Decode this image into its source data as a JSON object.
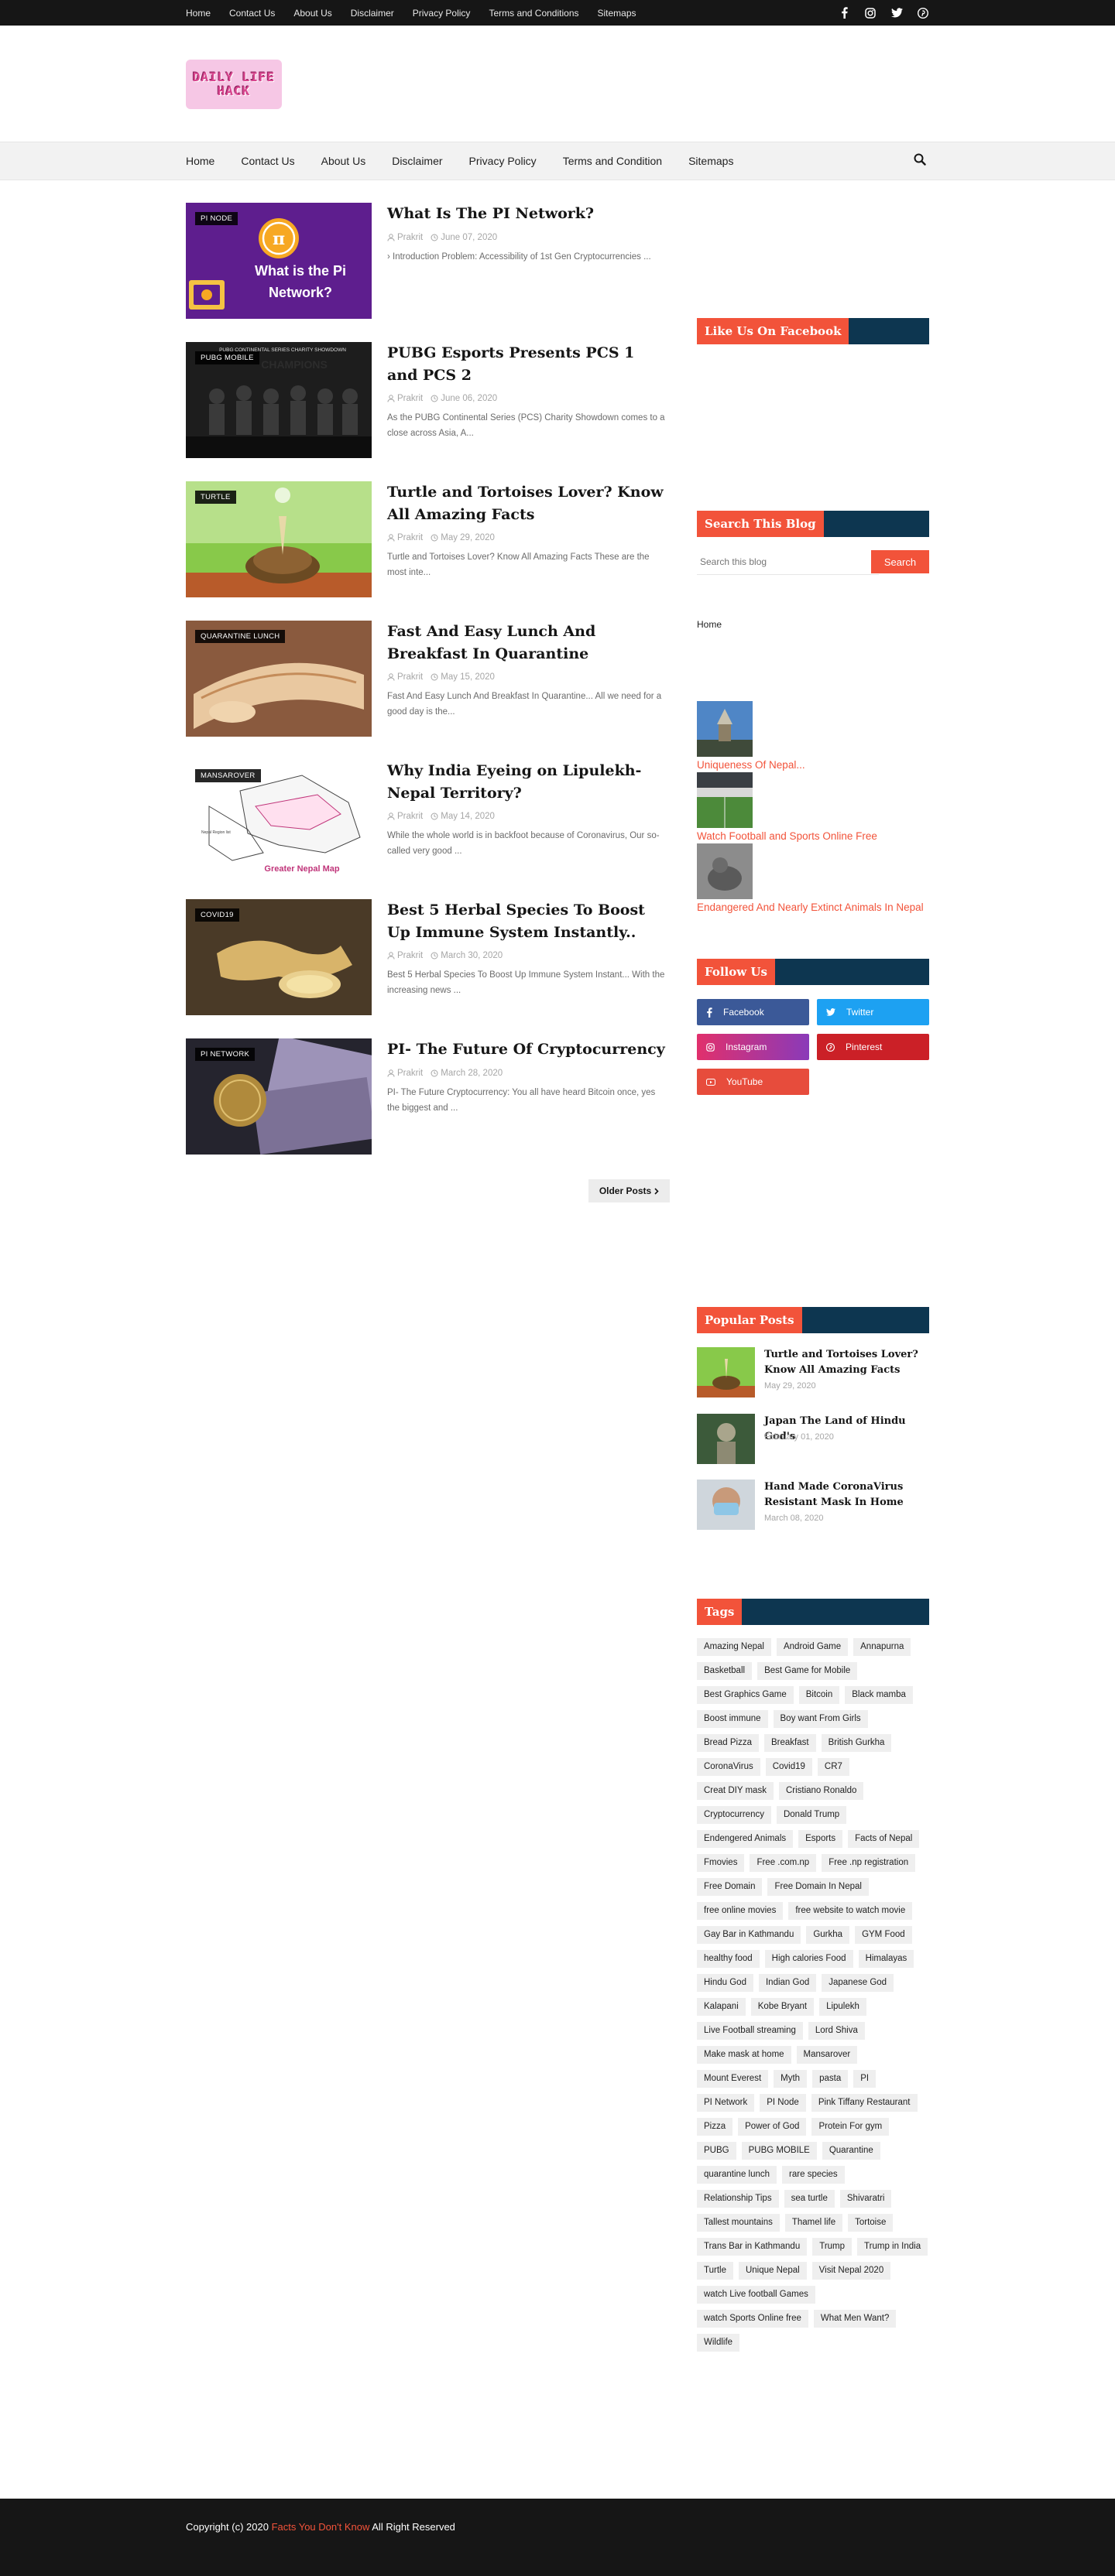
{
  "topbar": {
    "links": [
      "Home",
      "Contact Us",
      "About Us",
      "Disclaimer",
      "Privacy Policy",
      "Terms and Conditions",
      "Sitemaps"
    ],
    "social_icons": [
      "facebook-icon",
      "instagram-icon",
      "twitter-icon",
      "pinterest-icon"
    ]
  },
  "header": {
    "logo_line1": "DAILY LIFE",
    "logo_line2": "HACK"
  },
  "mainnav": {
    "links": [
      "Home",
      "Contact Us",
      "About Us",
      "Disclaimer",
      "Privacy Policy",
      "Terms and Condition",
      "Sitemaps"
    ],
    "search_icon": "search-icon"
  },
  "posts": [
    {
      "label": "PI NODE",
      "title": "What Is The PI Network?",
      "author": "Prakrit",
      "date": "June 07, 2020",
      "snippet": "› Introduction Problem: Accessibility of 1st Gen Cryptocurrencies ...",
      "thumb_text": "What is the Pi Network?",
      "thumb_color": "#6a1b9a"
    },
    {
      "label": "PUBG MOBILE",
      "title": "PUBG Esports Presents PCS 1 and PCS 2",
      "author": "Prakrit",
      "date": "June 06, 2020",
      "snippet": "As the PUBG Continental Series (PCS) Charity Showdown comes to a close across Asia, A...",
      "thumb_text": "PUBG CONTINENTAL SERIES CHARITY SHOWDOWN",
      "thumb_color": "#111111"
    },
    {
      "label": "TURTLE",
      "title": "Turtle and Tortoises Lover? Know All Amazing Facts",
      "author": "Prakrit",
      "date": "May 29, 2020",
      "snippet": "Turtle and Tortoises Lover? Know All Amazing Facts  These are the most inte...",
      "thumb_text": "",
      "thumb_color": "#7bbf3a"
    },
    {
      "label": "QUARANTINE LUNCH",
      "title": "Fast And Easy Lunch And Breakfast In Quarantine",
      "author": "Prakrit",
      "date": "May 15, 2020",
      "snippet": "Fast And Easy Lunch And Breakfast In Quarantine...   All we need for a good day is the...",
      "thumb_text": "",
      "thumb_color": "#d9a273"
    },
    {
      "label": "MANSAROVER",
      "title": "Why India Eyeing on Lipulekh-Nepal Territory?",
      "author": "Prakrit",
      "date": "May 14, 2020",
      "snippet": "While the whole world is in backfoot because of Coronavirus, Our so-called very good ...",
      "thumb_text": "Greater Nepal Map",
      "thumb_color": "#ffffff"
    },
    {
      "label": "COVID19",
      "title": "Best 5 Herbal Species To Boost Up Immune System Instantly..",
      "author": "Prakrit",
      "date": "March 30, 2020",
      "snippet": "Best 5 Herbal Species To Boost Up Immune System Instant...   With the increasing news ...",
      "thumb_text": "",
      "thumb_color": "#6b5535"
    },
    {
      "label": "PI NETWORK",
      "title": "PI- The Future Of Cryptocurrency",
      "author": "Prakrit",
      "date": "March 28, 2020",
      "snippet": "PI- The Future Cryptocurrency: You all have heard Bitcoin once, yes the biggest and ...",
      "thumb_text": "",
      "thumb_color": "#2b2b3a"
    }
  ],
  "pagination": {
    "older_label": "Older Posts"
  },
  "sidebar": {
    "facebook_title": "Like Us On Facebook",
    "search_title": "Search This Blog",
    "search_placeholder": "Search this blog",
    "search_button": "Search",
    "home_link": "Home",
    "image_links": [
      "Uniqueness Of Nepal...",
      "Watch Football and Sports Online Free",
      "Endangered And Nearly Extinct Animals In Nepal"
    ],
    "follow_title": "Follow Us",
    "follow_buttons": [
      {
        "label": "Facebook",
        "color": "#3b5998",
        "icon": "facebook-icon"
      },
      {
        "label": "Twitter",
        "color": "#1da1f2",
        "icon": "twitter-icon"
      },
      {
        "label": "Instagram",
        "color": "#c13584",
        "icon": "instagram-icon"
      },
      {
        "label": "Pinterest",
        "color": "#cb2027",
        "icon": "pinterest-icon"
      },
      {
        "label": "YouTube",
        "color": "#e74c3c",
        "icon": "youtube-icon"
      }
    ],
    "popular_title": "Popular Posts",
    "popular": [
      {
        "title": "Turtle and Tortoises Lover? Know All Amazing Facts",
        "date": "May 29, 2020"
      },
      {
        "title": "Japan The Land of Hindu God's",
        "date": "February 01, 2020"
      },
      {
        "title": "Hand Made CoronaVirus Resistant Mask In Home",
        "date": "March 08, 2020"
      }
    ],
    "tags_title": "Tags",
    "tags": [
      "Amazing Nepal",
      "Android Game",
      "Annapurna",
      "Basketball",
      "Best Game for Mobile",
      "Best Graphics Game",
      "Bitcoin",
      "Black mamba",
      "Boost immune",
      "Boy want From Girls",
      "Bread Pizza",
      "Breakfast",
      "British Gurkha",
      "CoronaVirus",
      "Covid19",
      "CR7",
      "Creat DIY mask",
      "Cristiano Ronaldo",
      "Cryptocurrency",
      "Donald Trump",
      "Endengered Animals",
      "Esports",
      "Facts of Nepal",
      "Fmovies",
      "Free .com.np",
      "Free .np registration",
      "Free Domain",
      "Free Domain In Nepal",
      "free online movies",
      "free website to watch movie",
      "Gay Bar in Kathmandu",
      "Gurkha",
      "GYM Food",
      "healthy food",
      "High calories Food",
      "Himalayas",
      "Hindu God",
      "Indian God",
      "Japanese God",
      "Kalapani",
      "Kobe Bryant",
      "Lipulekh",
      "Live Football streaming",
      "Lord Shiva",
      "Make mask at home",
      "Mansarover",
      "Mount Everest",
      "Myth",
      "pasta",
      "PI",
      "PI Network",
      "PI Node",
      "Pink Tiffany Restaurant",
      "Pizza",
      "Power of God",
      "Protein For gym",
      "PUBG",
      "PUBG MOBILE",
      "Quarantine",
      "quarantine lunch",
      "rare species",
      "Relationship Tips",
      "sea turtle",
      "Shivaratri",
      "Tallest mountains",
      "Thamel life",
      "Tortoise",
      "Trans Bar in Kathmandu",
      "Trump",
      "Trump in India",
      "Turtle",
      "Unique Nepal",
      "Visit Nepal 2020",
      "watch Live football Games",
      "watch Sports Online free",
      "What Men Want?",
      "Wildlife"
    ]
  },
  "footer": {
    "prefix": "Copyright (c) 2020 ",
    "brand": "Facts You Don't Know",
    "suffix": " All Right Reserved"
  },
  "colors": {
    "accent": "#f2533a",
    "navy": "#0d3650",
    "dark": "#161616"
  }
}
